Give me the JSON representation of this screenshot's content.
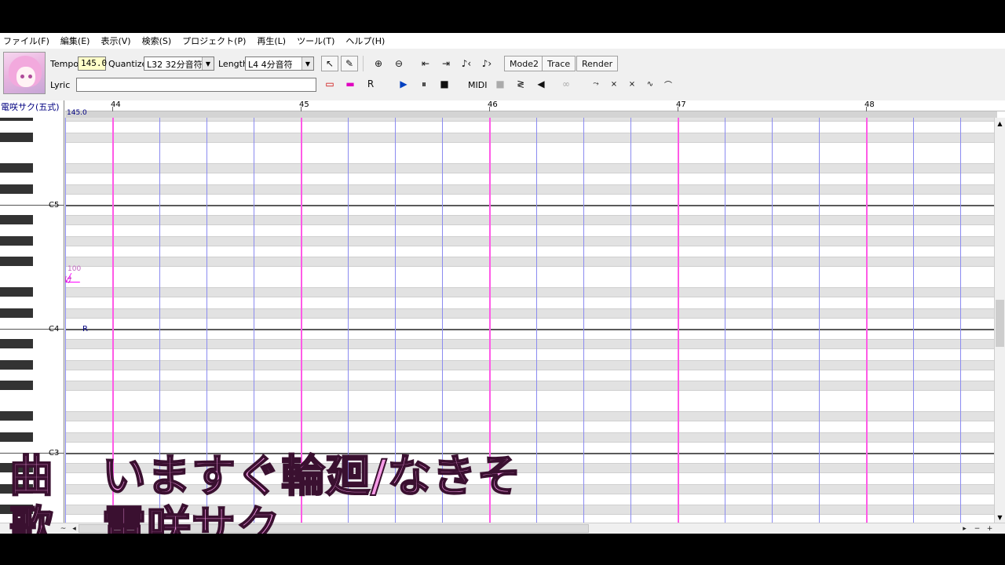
{
  "menu": [
    "ファイル(F)",
    "編集(E)",
    "表示(V)",
    "検索(S)",
    "プロジェクト(P)",
    "再生(L)",
    "ツール(T)",
    "ヘルプ(H)"
  ],
  "toolbar": {
    "tempo_label": "Tempo",
    "tempo_value": "145.0",
    "quantize_label": "Quantize",
    "quantize_value": "L32 32分音符",
    "length_label": "Length",
    "length_value": "L4  4分音符",
    "lyric_label": "Lyric",
    "lyric_value": "",
    "midi_label": "MIDI",
    "mode2_label": "Mode2",
    "trace_label": "Trace",
    "render_label": "Render"
  },
  "track": {
    "name": "電咲サク(五式)",
    "tempo_marker": "145.0"
  },
  "ruler": {
    "bars": [
      "44",
      "45",
      "46",
      "47",
      "48"
    ]
  },
  "piano_roll": {
    "octave_labels": [
      "C5",
      "C4",
      "C3"
    ],
    "note": {
      "lyric": "け",
      "velocity": "100"
    },
    "rest_label": "R"
  },
  "caption": {
    "song_label": "曲",
    "song_title": "いますぐ輪廻/なきそ",
    "singer_label": "歌",
    "singer_name": "電咲サク"
  },
  "colors": {
    "measure_line": "#ff5ae6",
    "beat_line": "#8b8bf0",
    "caption_fill": "#f59ae6",
    "track_name": "#000080"
  },
  "icons": [
    "pointer-icon",
    "pencil-icon",
    "zoom-in-icon",
    "zoom-out-icon",
    "go-start-icon",
    "go-end-icon",
    "prev-note-icon",
    "next-note-icon",
    "play-icon",
    "pause-icon",
    "stop-icon"
  ]
}
